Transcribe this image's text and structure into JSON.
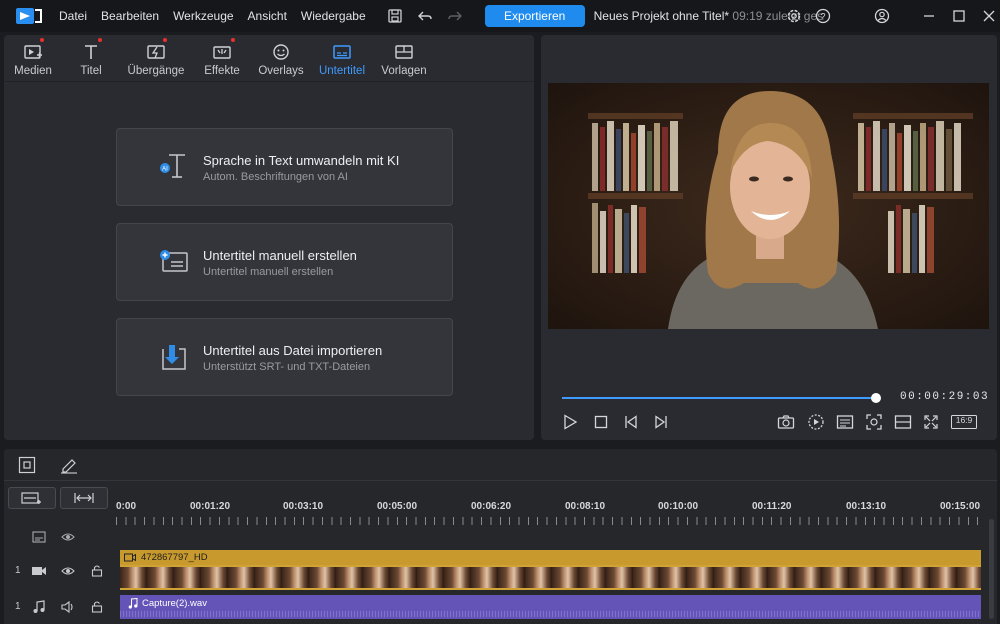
{
  "menu": [
    "Datei",
    "Bearbeiten",
    "Werkzeuge",
    "Ansicht",
    "Wiedergabe"
  ],
  "toolbar": {
    "export_label": "Exportieren",
    "project_title": "Neues Projekt ohne Titel*",
    "saved_status": "09:19 zuletzt gespeich"
  },
  "tabs": [
    {
      "label": "Medien",
      "dot": true
    },
    {
      "label": "Titel",
      "dot": true
    },
    {
      "label": "Übergänge",
      "dot": true
    },
    {
      "label": "Effekte",
      "dot": true
    },
    {
      "label": "Overlays",
      "dot": false
    },
    {
      "label": "Untertitel",
      "dot": false,
      "active": true
    },
    {
      "label": "Vorlagen",
      "dot": false
    }
  ],
  "cards": [
    {
      "title": "Sprache in Text umwandeln mit KI",
      "subtitle": "Autom. Beschriftungen von AI"
    },
    {
      "title": "Untertitel manuell erstellen",
      "subtitle": "Untertitel manuell erstellen"
    },
    {
      "title": "Untertitel aus Datei importieren",
      "subtitle": "Unterstützt SRT- und TXT-Dateien"
    }
  ],
  "player": {
    "timecode": "00:00:29:03",
    "progress": 1.0,
    "aspect_label": "16:9"
  },
  "timeline": {
    "ruler": [
      "0:00",
      "00:01:20",
      "00:03:10",
      "00:05:00",
      "00:06:20",
      "00:08:10",
      "00:10:00",
      "00:11:20",
      "00:13:10",
      "00:15:00"
    ],
    "video_track_number": "1",
    "audio_track_number": "1",
    "video_clip": "472867797_HD",
    "audio_clip": "Capture(2).wav"
  },
  "colors": {
    "accent": "#1f8bef",
    "video_clip": "#c89a2d",
    "audio_clip": "#6554b8"
  }
}
